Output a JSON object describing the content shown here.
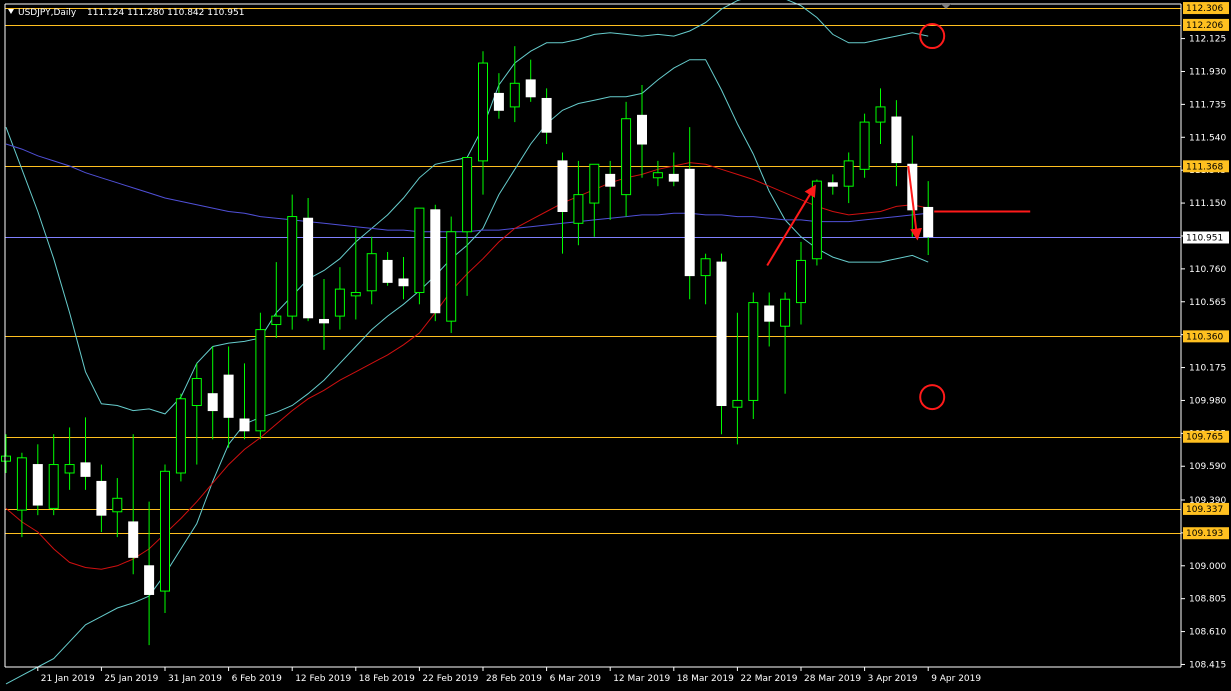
{
  "chart_data": {
    "type": "candlestick",
    "symbol_title": "USDJPY,Daily",
    "ohlc_header": "111.124 111.280 110.842 110.951",
    "current_price": "110.951",
    "colors": {
      "background": "#000000",
      "axis": "#ffffff",
      "candle_bull_fill": "#000000",
      "candle_bear_fill": "#ffffff",
      "candle_outline": "#ffffff",
      "wick": "#00ff00",
      "bollinger": "#66cccc",
      "ma_red": "#d01010",
      "ma_blue": "#5050d8",
      "hline": "#ffc020",
      "hline_label_bg": "#ffc020",
      "hline_label_text": "#000000",
      "current_price_bg": "#ffffff",
      "current_price_text": "#000000",
      "current_price_line": "#8080ff",
      "annotation": "#ff1a1a",
      "axis_text": "#ffffff"
    },
    "y_axis_ticks": [
      "112.125",
      "111.930",
      "111.735",
      "111.540",
      "111.345",
      "111.150",
      "110.955",
      "110.760",
      "110.565",
      "110.370",
      "110.175",
      "109.980",
      "109.785",
      "109.590",
      "109.390",
      "109.195",
      "109.000",
      "108.805",
      "108.610",
      "108.415"
    ],
    "y_axis_tick_values": [
      112.125,
      111.93,
      111.735,
      111.54,
      111.345,
      111.15,
      110.955,
      110.76,
      110.565,
      110.37,
      110.175,
      109.98,
      109.785,
      109.59,
      109.39,
      109.195,
      109.0,
      108.805,
      108.61,
      108.415
    ],
    "ylim": [
      108.4,
      112.33
    ],
    "horizontal_levels": [
      {
        "label": "112.306",
        "value": 112.306
      },
      {
        "label": "112.206",
        "value": 112.206
      },
      {
        "label": "111.368",
        "value": 111.368
      },
      {
        "label": "110.360",
        "value": 110.36
      },
      {
        "label": "109.765",
        "value": 109.765
      },
      {
        "label": "109.337",
        "value": 109.337
      },
      {
        "label": "109.193",
        "value": 109.193
      }
    ],
    "x_axis_labels": [
      "21 Jan 2019",
      "25 Jan 2019",
      "31 Jan 2019",
      "6 Feb 2019",
      "12 Feb 2019",
      "18 Feb 2019",
      "22 Feb 2019",
      "28 Feb 2019",
      "6 Mar 2019",
      "12 Mar 2019",
      "18 Mar 2019",
      "22 Mar 2019",
      "28 Mar 2019",
      "3 Apr 2019",
      "9 Apr 2019"
    ],
    "x_axis_label_bars": [
      2,
      6,
      10,
      14,
      18,
      22,
      26,
      30,
      34,
      38,
      42,
      46,
      50,
      54,
      58
    ],
    "candles": [
      {
        "o": 109.62,
        "h": 109.78,
        "l": 109.55,
        "c": 109.65
      },
      {
        "o": 109.33,
        "h": 109.67,
        "l": 109.17,
        "c": 109.64
      },
      {
        "o": 109.6,
        "h": 109.72,
        "l": 109.3,
        "c": 109.36
      },
      {
        "o": 109.34,
        "h": 109.78,
        "l": 109.3,
        "c": 109.6
      },
      {
        "o": 109.55,
        "h": 109.82,
        "l": 109.45,
        "c": 109.6
      },
      {
        "o": 109.61,
        "h": 109.88,
        "l": 109.45,
        "c": 109.53
      },
      {
        "o": 109.5,
        "h": 109.6,
        "l": 109.2,
        "c": 109.3
      },
      {
        "o": 109.32,
        "h": 109.52,
        "l": 109.17,
        "c": 109.4
      },
      {
        "o": 109.26,
        "h": 109.78,
        "l": 108.95,
        "c": 109.05
      },
      {
        "o": 109.0,
        "h": 109.38,
        "l": 108.53,
        "c": 108.83
      },
      {
        "o": 108.85,
        "h": 109.6,
        "l": 108.72,
        "c": 109.56
      },
      {
        "o": 109.55,
        "h": 110.02,
        "l": 109.5,
        "c": 109.99
      },
      {
        "o": 109.95,
        "h": 110.2,
        "l": 109.6,
        "c": 110.11
      },
      {
        "o": 110.02,
        "h": 110.3,
        "l": 109.75,
        "c": 109.92
      },
      {
        "o": 110.13,
        "h": 110.3,
        "l": 109.7,
        "c": 109.88
      },
      {
        "o": 109.87,
        "h": 110.2,
        "l": 109.75,
        "c": 109.8
      },
      {
        "o": 109.8,
        "h": 110.5,
        "l": 109.75,
        "c": 110.4
      },
      {
        "o": 110.43,
        "h": 110.8,
        "l": 110.35,
        "c": 110.48
      },
      {
        "o": 110.48,
        "h": 111.2,
        "l": 110.4,
        "c": 111.07
      },
      {
        "o": 111.06,
        "h": 111.18,
        "l": 110.45,
        "c": 110.47
      },
      {
        "o": 110.46,
        "h": 110.7,
        "l": 110.28,
        "c": 110.44
      },
      {
        "o": 110.48,
        "h": 110.77,
        "l": 110.4,
        "c": 110.64
      },
      {
        "o": 110.6,
        "h": 111.0,
        "l": 110.46,
        "c": 110.62
      },
      {
        "o": 110.63,
        "h": 110.95,
        "l": 110.55,
        "c": 110.85
      },
      {
        "o": 110.81,
        "h": 110.86,
        "l": 110.66,
        "c": 110.68
      },
      {
        "o": 110.7,
        "h": 110.83,
        "l": 110.58,
        "c": 110.66
      },
      {
        "o": 110.62,
        "h": 111.12,
        "l": 110.55,
        "c": 111.12
      },
      {
        "o": 111.11,
        "h": 111.14,
        "l": 110.45,
        "c": 110.5
      },
      {
        "o": 110.45,
        "h": 111.07,
        "l": 110.38,
        "c": 110.98
      },
      {
        "o": 110.98,
        "h": 111.42,
        "l": 110.6,
        "c": 111.42
      },
      {
        "o": 111.4,
        "h": 112.05,
        "l": 111.2,
        "c": 111.98
      },
      {
        "o": 111.8,
        "h": 111.92,
        "l": 111.65,
        "c": 111.7
      },
      {
        "o": 111.72,
        "h": 112.08,
        "l": 111.63,
        "c": 111.86
      },
      {
        "o": 111.88,
        "h": 112.0,
        "l": 111.75,
        "c": 111.78
      },
      {
        "o": 111.77,
        "h": 111.83,
        "l": 111.5,
        "c": 111.57
      },
      {
        "o": 111.4,
        "h": 111.45,
        "l": 110.85,
        "c": 111.1
      },
      {
        "o": 111.03,
        "h": 111.4,
        "l": 110.9,
        "c": 111.2
      },
      {
        "o": 111.15,
        "h": 111.38,
        "l": 110.95,
        "c": 111.38
      },
      {
        "o": 111.32,
        "h": 111.4,
        "l": 111.05,
        "c": 111.25
      },
      {
        "o": 111.2,
        "h": 111.75,
        "l": 111.07,
        "c": 111.65
      },
      {
        "o": 111.67,
        "h": 111.85,
        "l": 111.3,
        "c": 111.5
      },
      {
        "o": 111.3,
        "h": 111.4,
        "l": 111.25,
        "c": 111.33
      },
      {
        "o": 111.32,
        "h": 111.45,
        "l": 111.25,
        "c": 111.28
      },
      {
        "o": 111.35,
        "h": 111.6,
        "l": 110.58,
        "c": 110.72
      },
      {
        "o": 110.72,
        "h": 110.85,
        "l": 110.55,
        "c": 110.82
      },
      {
        "o": 110.8,
        "h": 110.85,
        "l": 109.78,
        "c": 109.95
      },
      {
        "o": 109.94,
        "h": 110.5,
        "l": 109.72,
        "c": 109.98
      },
      {
        "o": 109.98,
        "h": 110.62,
        "l": 109.87,
        "c": 110.56
      },
      {
        "o": 110.54,
        "h": 110.62,
        "l": 110.3,
        "c": 110.45
      },
      {
        "o": 110.42,
        "h": 110.62,
        "l": 110.02,
        "c": 110.58
      },
      {
        "o": 110.56,
        "h": 110.92,
        "l": 110.43,
        "c": 110.81
      },
      {
        "o": 110.82,
        "h": 111.29,
        "l": 110.78,
        "c": 111.28
      },
      {
        "o": 111.27,
        "h": 111.32,
        "l": 111.2,
        "c": 111.25
      },
      {
        "o": 111.25,
        "h": 111.45,
        "l": 111.15,
        "c": 111.4
      },
      {
        "o": 111.35,
        "h": 111.68,
        "l": 111.3,
        "c": 111.63
      },
      {
        "o": 111.63,
        "h": 111.83,
        "l": 111.5,
        "c": 111.72
      },
      {
        "o": 111.66,
        "h": 111.76,
        "l": 111.25,
        "c": 111.39
      },
      {
        "o": 111.38,
        "h": 111.55,
        "l": 110.95,
        "c": 111.11
      },
      {
        "o": 111.124,
        "h": 111.28,
        "l": 110.842,
        "c": 110.951
      }
    ],
    "ma_red": [
      109.34,
      109.26,
      109.2,
      109.1,
      109.02,
      108.99,
      108.98,
      109.0,
      109.04,
      109.1,
      109.19,
      109.28,
      109.38,
      109.49,
      109.6,
      109.69,
      109.76,
      109.84,
      109.92,
      109.99,
      110.04,
      110.1,
      110.15,
      110.2,
      110.25,
      110.31,
      110.38,
      110.5,
      110.63,
      110.73,
      110.82,
      110.92,
      111.0,
      111.05,
      111.1,
      111.15,
      111.19,
      111.23,
      111.27,
      111.3,
      111.32,
      111.35,
      111.37,
      111.39,
      111.38,
      111.35,
      111.32,
      111.29,
      111.25,
      111.21,
      111.17,
      111.13,
      111.1,
      111.08,
      111.09,
      111.1,
      111.13,
      111.14,
      111.12
    ],
    "ma_blue": [
      111.5,
      111.47,
      111.43,
      111.4,
      111.37,
      111.33,
      111.3,
      111.27,
      111.24,
      111.21,
      111.18,
      111.16,
      111.14,
      111.12,
      111.1,
      111.09,
      111.07,
      111.06,
      111.05,
      111.04,
      111.03,
      111.02,
      111.01,
      111.0,
      110.99,
      110.99,
      110.98,
      110.98,
      110.98,
      110.98,
      110.99,
      110.99,
      111.0,
      111.01,
      111.02,
      111.03,
      111.04,
      111.05,
      111.06,
      111.07,
      111.08,
      111.08,
      111.09,
      111.09,
      111.08,
      111.08,
      111.07,
      111.07,
      111.06,
      111.05,
      111.05,
      111.04,
      111.04,
      111.04,
      111.05,
      111.06,
      111.07,
      111.08,
      111.09
    ],
    "bb_upper": [
      111.6,
      111.35,
      111.1,
      110.82,
      110.5,
      110.15,
      109.96,
      109.95,
      109.92,
      109.93,
      109.9,
      110.0,
      110.2,
      110.3,
      110.32,
      110.33,
      110.35,
      110.5,
      110.6,
      110.7,
      110.75,
      110.82,
      110.92,
      111.0,
      111.08,
      111.18,
      111.3,
      111.38,
      111.4,
      111.42,
      111.6,
      111.85,
      111.98,
      112.05,
      112.1,
      112.1,
      112.12,
      112.15,
      112.16,
      112.15,
      112.14,
      112.15,
      112.14,
      112.17,
      112.22,
      112.3,
      112.35,
      112.38,
      112.38,
      112.36,
      112.32,
      112.25,
      112.15,
      112.1,
      112.1,
      112.12,
      112.14,
      112.16,
      112.14
    ],
    "bb_lower": [
      108.3,
      108.35,
      108.4,
      108.45,
      108.55,
      108.65,
      108.7,
      108.75,
      108.78,
      108.82,
      108.95,
      109.1,
      109.25,
      109.5,
      109.72,
      109.84,
      109.88,
      109.91,
      109.95,
      110.02,
      110.1,
      110.2,
      110.3,
      110.4,
      110.48,
      110.55,
      110.63,
      110.72,
      110.82,
      110.9,
      111.0,
      111.2,
      111.35,
      111.5,
      111.62,
      111.7,
      111.74,
      111.76,
      111.78,
      111.78,
      111.8,
      111.88,
      111.95,
      112.0,
      112.0,
      111.82,
      111.62,
      111.44,
      111.22,
      111.05,
      110.95,
      110.88,
      110.83,
      110.8,
      110.8,
      110.8,
      110.82,
      110.84,
      110.8
    ]
  },
  "annotations": {
    "upper_circle": "upper-band-circle",
    "lower_circle": "lower-band-circle"
  }
}
